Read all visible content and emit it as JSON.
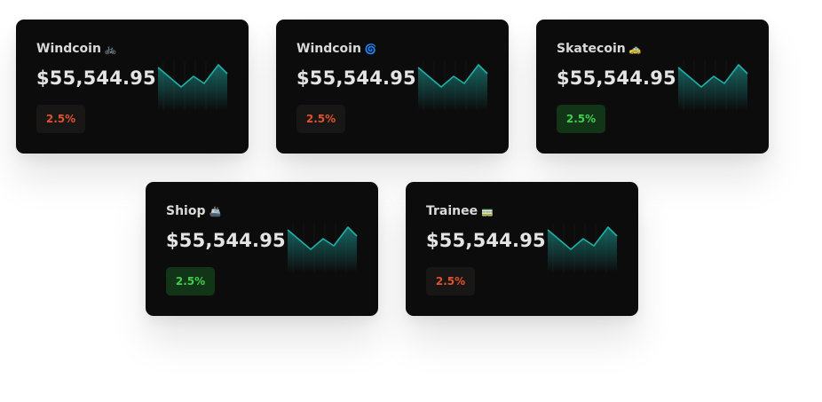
{
  "cards": [
    {
      "name": "Windcoin",
      "emoji": "🚲",
      "price": "$55,544.95",
      "change": "2.5%",
      "trend": "negative"
    },
    {
      "name": "Windcoin",
      "emoji": "🌀",
      "price": "$55,544.95",
      "change": "2.5%",
      "trend": "negative"
    },
    {
      "name": "Skatecoin",
      "emoji": "🚕",
      "price": "$55,544.95",
      "change": "2.5%",
      "trend": "positive"
    },
    {
      "name": "Shiop",
      "emoji": "🚢",
      "price": "$55,544.95",
      "change": "2.5%",
      "trend": "positive"
    },
    {
      "name": "Trainee",
      "emoji": "🚃",
      "price": "$55,544.95",
      "change": "2.5%",
      "trend": "negative"
    }
  ],
  "colors": {
    "card_bg": "#0c0c0c",
    "negative": "#e0512e",
    "positive": "#3fcf4c",
    "sparkline": "#1fb0a8"
  }
}
